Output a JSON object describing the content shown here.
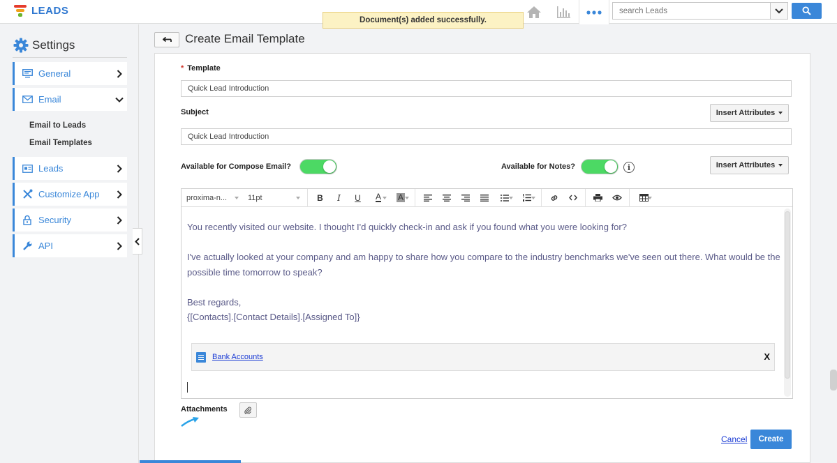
{
  "app": {
    "name": "LEADS"
  },
  "toast": {
    "message": "Document(s) added successfully."
  },
  "search": {
    "placeholder": "search Leads"
  },
  "sidebar": {
    "title": "Settings",
    "items": [
      {
        "label": "General",
        "icon": "monitor-icon"
      },
      {
        "label": "Email",
        "icon": "envelope-icon"
      },
      {
        "label": "Leads",
        "icon": "id-card-icon"
      },
      {
        "label": "Customize App",
        "icon": "tools-icon"
      },
      {
        "label": "Security",
        "icon": "lock-icon"
      },
      {
        "label": "API",
        "icon": "wrench-icon"
      }
    ],
    "email_subitems": [
      "Email to Leads",
      "Email Templates"
    ]
  },
  "page": {
    "title": "Create Email Template"
  },
  "form": {
    "template_label": "Template",
    "template_value": "Quick Lead Introduction",
    "subject_label": "Subject",
    "subject_value": "Quick Lead Introduction",
    "insert_attributes": "Insert Attributes",
    "compose_label": "Available for Compose Email?",
    "notes_label": "Available for Notes?",
    "compose_enabled": true,
    "notes_enabled": true,
    "attachments_label": "Attachments",
    "cancel": "Cancel",
    "create": "Create"
  },
  "editor": {
    "font": "proxima-n...",
    "size": "11pt",
    "paragraphs": [
      "You recently visited our website. I thought I'd quickly check-in and ask if you found what you were looking for?",
      "I've actually looked at your company and am happy to share how you compare to the industry benchmarks we've seen out there. What would be the possible time tomorrow to speak?",
      "Best regards,",
      "{[Contacts].[Contact Details].[Assigned To]}"
    ],
    "attachment_name": "Bank Accounts",
    "attachment_remove": "X"
  },
  "colors": {
    "accent": "#3a87d9",
    "toggle_on": "#4cd964",
    "toast_bg": "#fcf2c4"
  }
}
